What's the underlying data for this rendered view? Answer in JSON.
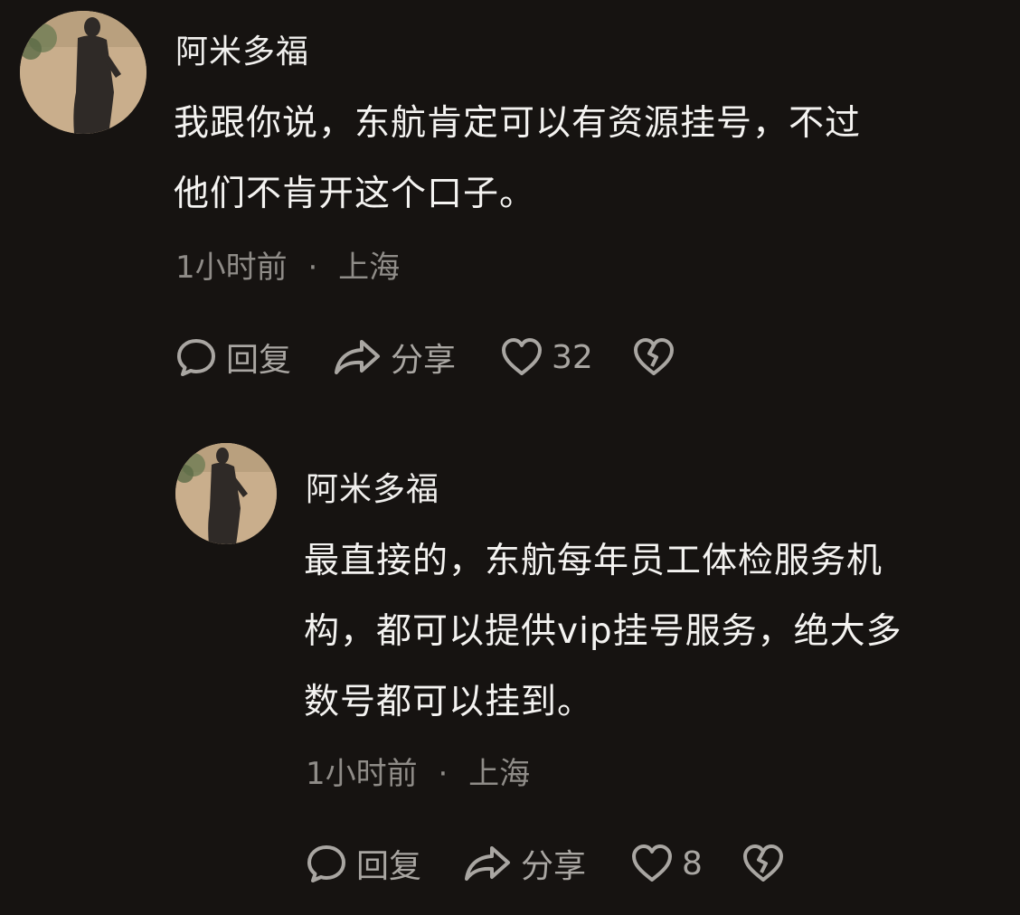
{
  "comments": [
    {
      "username": "阿米多福",
      "lines": [
        "我跟你说，东航肯定可以有资源挂号，不过",
        "他们不肯开这个口子。"
      ],
      "time": "1小时前",
      "separator": "·",
      "location": "上海",
      "actions": {
        "reply": "回复",
        "share": "分享",
        "likes": "32"
      }
    },
    {
      "username": "阿米多福",
      "lines": [
        "最直接的，东航每年员工体检服务机",
        "构，都可以提供vip挂号服务，绝大多",
        "数号都可以挂到。"
      ],
      "time": "1小时前",
      "separator": "·",
      "location": "上海",
      "actions": {
        "reply": "回复",
        "share": "分享",
        "likes": "8"
      }
    }
  ],
  "icons": {
    "reply": "comment-bubble-icon",
    "share": "share-arrow-icon",
    "like": "heart-icon",
    "dislike": "broken-heart-icon"
  },
  "colors": {
    "background": "#161311",
    "text": "#f4f3f1",
    "meta": "#8f8c88",
    "action": "#a9a6a2"
  }
}
